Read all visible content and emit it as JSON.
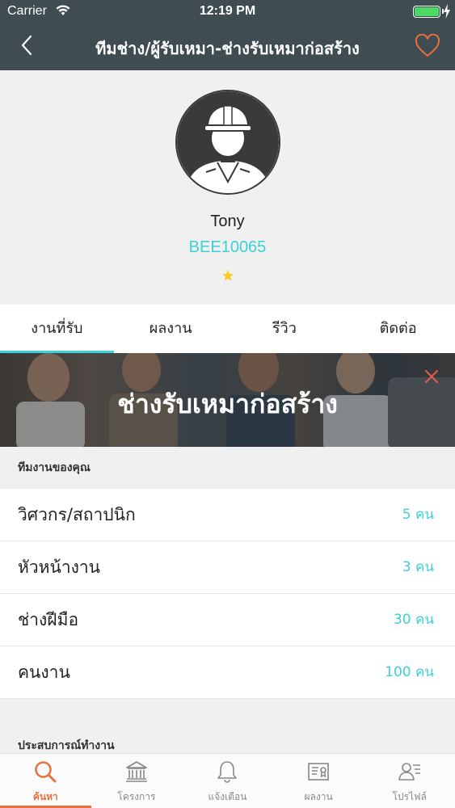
{
  "status_bar": {
    "carrier": "Carrier",
    "time": "12:19 PM"
  },
  "nav": {
    "title": "ทีมช่าง/ผู้รับเหมา-ช่างรับเหมาก่อสร้าง"
  },
  "profile": {
    "name": "Tony",
    "code": "BEE10065",
    "rating_stars": 1
  },
  "tabs": [
    {
      "label": "งานที่รับ",
      "active": true
    },
    {
      "label": "ผลงาน",
      "active": false
    },
    {
      "label": "รีวิว",
      "active": false
    },
    {
      "label": "ติดต่อ",
      "active": false
    }
  ],
  "banner": {
    "title": "ช่างรับเหมาก่อสร้าง"
  },
  "team": {
    "heading": "ทีมงานของคุณ",
    "rows": [
      {
        "label": "วิศวกร/สถาปนิก",
        "value": "5 คน"
      },
      {
        "label": "หัวหน้างาน",
        "value": "3 คน"
      },
      {
        "label": "ช่างฝีมือ",
        "value": "30 คน"
      },
      {
        "label": "คนงาน",
        "value": "100 คน"
      }
    ]
  },
  "experience": {
    "heading": "ประสบการณ์ทำงาน"
  },
  "tabbar": [
    {
      "label": "ค้นหา",
      "icon": "search-icon",
      "active": true
    },
    {
      "label": "โครงการ",
      "icon": "bank-icon",
      "active": false
    },
    {
      "label": "แจ้งเตือน",
      "icon": "bell-icon",
      "active": false
    },
    {
      "label": "ผลงาน",
      "icon": "certificate-icon",
      "active": false
    },
    {
      "label": "โปรไฟล์",
      "icon": "profile-icon",
      "active": false
    }
  ],
  "colors": {
    "accent": "#3dd0d8",
    "tab_active": "#e8703a",
    "header": "#3f4c52"
  }
}
